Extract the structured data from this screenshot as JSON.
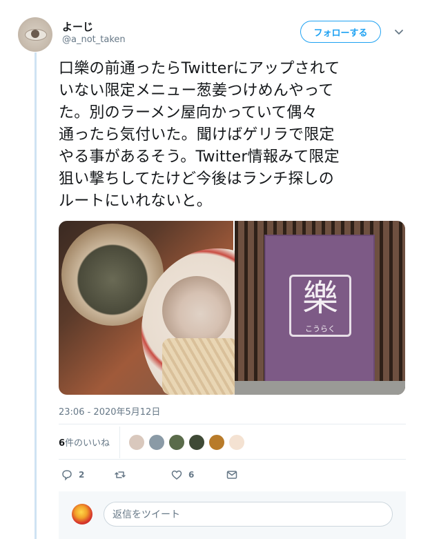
{
  "user": {
    "display_name": "よーじ",
    "username": "@a_not_taken"
  },
  "follow_button_label": "フォローする",
  "tweet": {
    "lines": [
      "口樂の前通ったらTwitterにアップされて",
      "いない限定メニュー葱姜つけめんやって",
      "た。別のラーメン屋向かっていて偶々",
      "通ったら気付いた。聞けばゲリラで限定",
      "やる事があるそう。Twitter情報みて限定",
      "狙い撃ちしてたけど今後はランチ探しの",
      "ルートにいれないと。"
    ],
    "media": {
      "photo_left": "tsukemen-photo",
      "photo_right": "shop-noren-photo",
      "noren_text": "樂",
      "noren_subtext": "こうらく"
    },
    "timestamp": "23:06 - 2020年5月12日"
  },
  "likes": {
    "count_number": "6",
    "count_suffix": "件のいいね",
    "liker_colors": [
      "#d9c8bd",
      "#8a9aa6",
      "#5a6b4a",
      "#3f4a36",
      "#b87b2a",
      "#f4e2d2"
    ]
  },
  "actions": {
    "reply_count": "2",
    "retweet_count": "",
    "like_count": "6"
  },
  "reply": {
    "placeholder": "返信をツイート"
  },
  "colors": {
    "accent": "#1da1f2",
    "thread_line": "#cfe3f3",
    "muted": "#657786"
  }
}
